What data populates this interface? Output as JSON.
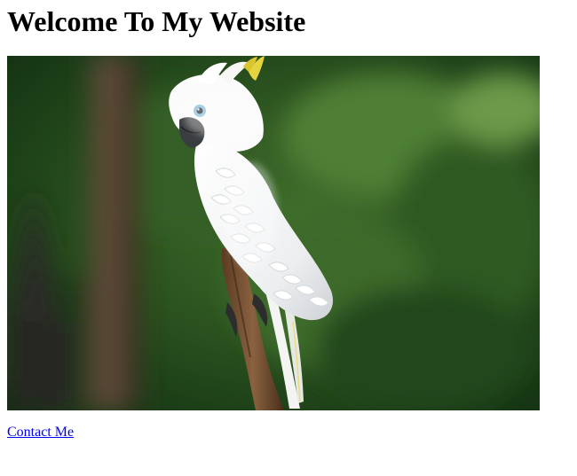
{
  "page": {
    "heading": "Welcome To My Website",
    "photo_subject": "white-cockatoo-on-branch",
    "link_color": "#0000ee"
  },
  "links": {
    "contact_label": "Contact Me"
  }
}
